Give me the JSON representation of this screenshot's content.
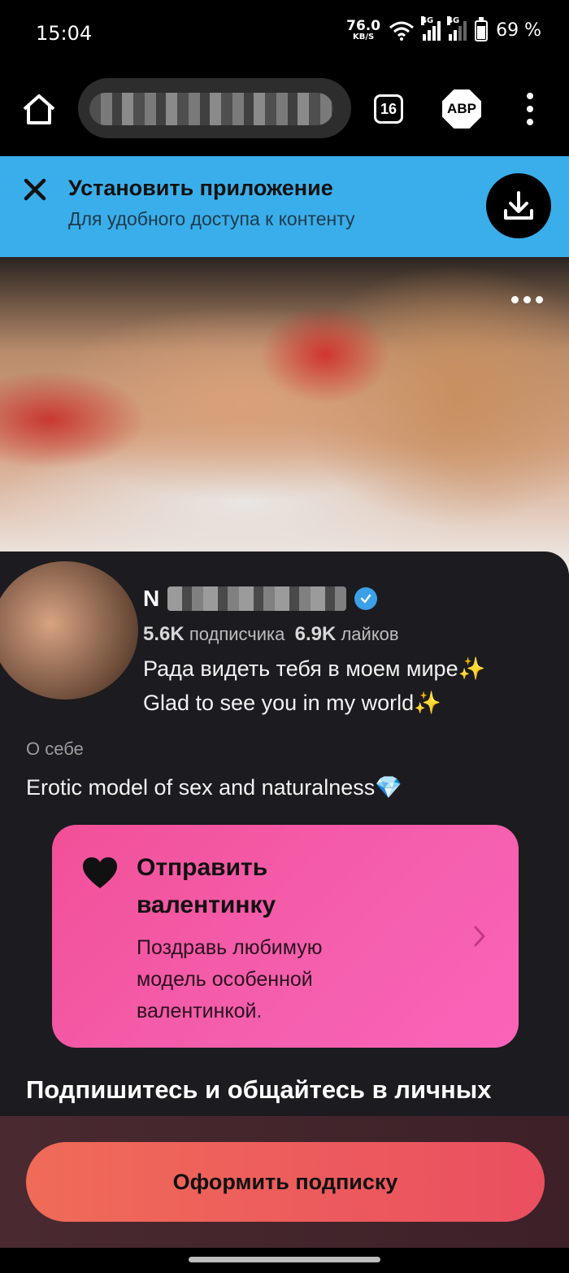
{
  "status_bar": {
    "time": "15:04",
    "net_speed_value": "76.0",
    "net_speed_unit": "KB/S",
    "signal_1_tag": "4G",
    "signal_2_tag": "4G",
    "battery_percent": "69 %",
    "battery_level": 0.69
  },
  "browser": {
    "tab_count": "16",
    "adblock_label": "ABP",
    "url_redacted": true
  },
  "install_banner": {
    "title": "Установить приложение",
    "subtitle": "Для удобного доступа к контенту",
    "accent_color": "#3aaeea"
  },
  "profile": {
    "name_initial": "N",
    "subscribers_count": "5.6K",
    "subscribers_label": "подписчика",
    "likes_count": "6.9K",
    "likes_label": "лайков",
    "greeting_ru": "Рада видеть тебя в моем мире✨",
    "greeting_en": "Glad to see you in my world✨",
    "about_label": "О себе",
    "about_text": "Erotic model of sex and naturalness💎"
  },
  "valentine_card": {
    "title": "Отправить валентинку",
    "subtitle": "Поздравь любимую модель особенной валентинкой.",
    "icon": "heart-icon"
  },
  "subscribe": {
    "heading": "Подпишитесь и общайтесь в личных",
    "button_label": "Оформить подписку"
  }
}
